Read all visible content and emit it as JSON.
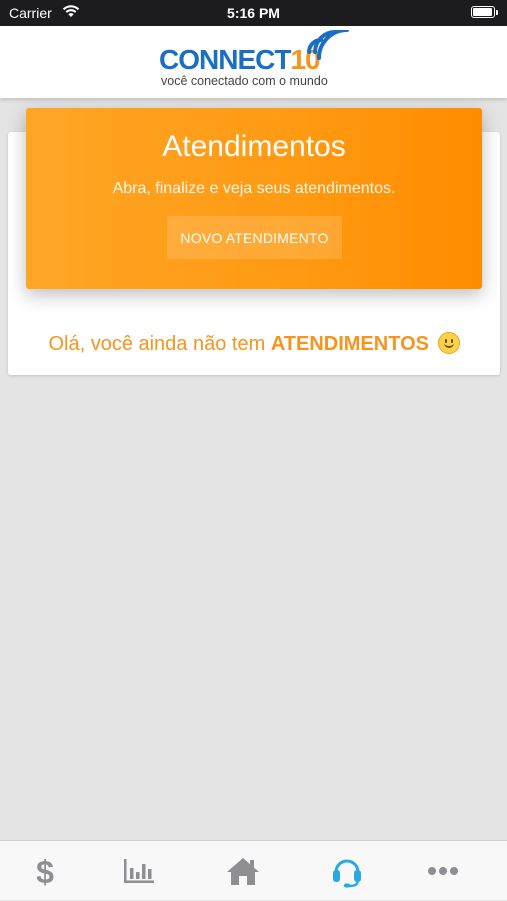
{
  "status_bar": {
    "carrier": "Carrier",
    "time": "5:16 PM"
  },
  "header": {
    "logo": {
      "brand_main": "CONNECT",
      "brand_num": "10",
      "tagline": "você conectado com o mundo"
    }
  },
  "banner": {
    "title": "Atendimentos",
    "subtitle": "Abra, finalize e veja seus atendimentos.",
    "button_label": "NOVO ATENDIMENTO"
  },
  "empty_state": {
    "prefix": "Olá, você ainda não tem ",
    "emphasis": "ATENDIMENTOS"
  },
  "colors": {
    "accent": "#f7941d",
    "brand_blue": "#1a6fc4",
    "active_tab": "#2aa8e0",
    "inactive_tab": "#8e8e93"
  },
  "tab_bar": {
    "items": [
      {
        "icon": "dollar-icon",
        "active": false
      },
      {
        "icon": "bar-chart-icon",
        "active": false
      },
      {
        "icon": "home-icon",
        "active": false
      },
      {
        "icon": "headset-icon",
        "active": true
      },
      {
        "icon": "more-icon",
        "active": false
      }
    ]
  }
}
